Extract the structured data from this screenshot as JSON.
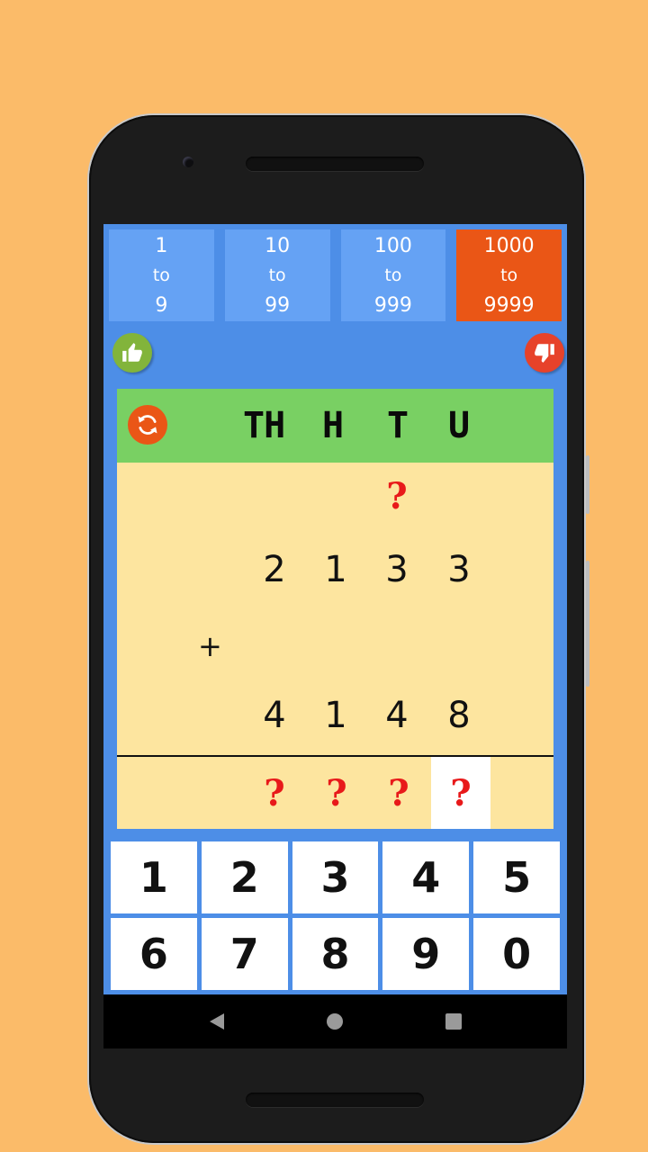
{
  "ranges": [
    {
      "from": "1",
      "to_word": "to",
      "to": "9",
      "selected": false
    },
    {
      "from": "10",
      "to_word": "to",
      "to": "99",
      "selected": false
    },
    {
      "from": "100",
      "to_word": "to",
      "to": "999",
      "selected": false
    },
    {
      "from": "1000",
      "to_word": "to",
      "to": "9999",
      "selected": true
    }
  ],
  "icons": {
    "like": "thumbs-up-icon",
    "dislike": "thumbs-down-icon",
    "refresh": "refresh-icon",
    "back": "back-triangle-icon",
    "home": "home-circle-icon",
    "recents": "recents-square-icon"
  },
  "place_values": [
    "TH",
    "H",
    "T",
    "U"
  ],
  "problem": {
    "carry_row": [
      "",
      "",
      "?",
      ""
    ],
    "addend1": [
      "2",
      "1",
      "3",
      "3"
    ],
    "operator": "+",
    "addend2": [
      "4",
      "1",
      "4",
      "8"
    ],
    "answer": [
      "?",
      "?",
      "?",
      "?"
    ],
    "focused_answer_index": 3
  },
  "keypad": [
    "1",
    "2",
    "3",
    "4",
    "5",
    "6",
    "7",
    "8",
    "9",
    "0"
  ],
  "colors": {
    "background": "#fbbb69",
    "screen": "#4d8ee7",
    "range_tile": "#65a2f4",
    "range_selected": "#ea5616",
    "header": "#79d063",
    "work_area": "#fde59f",
    "question_mark": "#e8191a",
    "like": "#82b43b",
    "dislike": "#e7422a"
  }
}
